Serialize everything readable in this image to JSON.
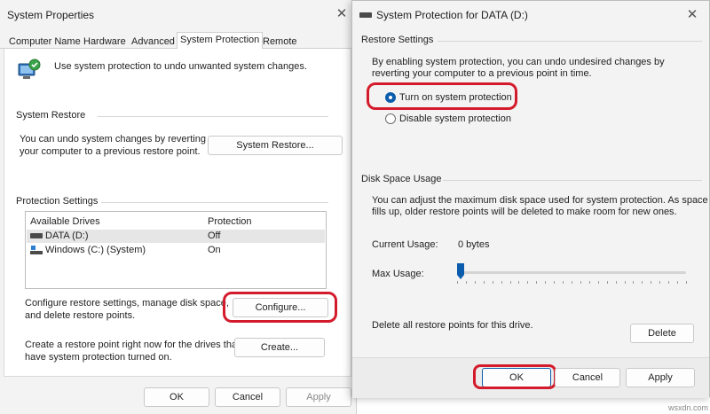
{
  "left_window": {
    "title": "System Properties",
    "close_glyph": "✕",
    "tabs": [
      "Computer Name",
      "Hardware",
      "Advanced",
      "System Protection",
      "Remote"
    ],
    "intro": "Use system protection to undo unwanted system changes.",
    "system_restore": {
      "heading": "System Restore",
      "line1": "You can undo system changes by reverting",
      "line2": "your computer to a previous restore point.",
      "button": "System Restore..."
    },
    "protection": {
      "heading": "Protection Settings",
      "col_drives": "Available Drives",
      "col_protection": "Protection",
      "rows": [
        {
          "name": "DATA (D:)",
          "status": "Off",
          "icon": "drive-icon"
        },
        {
          "name": "Windows (C:) (System)",
          "status": "On",
          "icon": "windows-drive-icon"
        }
      ],
      "configure_line1": "Configure restore settings, manage disk space,",
      "configure_line2": "and delete restore points.",
      "configure_button": "Configure...",
      "create_line1": "Create a restore point right now for the drives that",
      "create_line2": "have system protection turned on.",
      "create_button": "Create..."
    },
    "footer": {
      "ok": "OK",
      "cancel": "Cancel",
      "apply": "Apply"
    }
  },
  "right_window": {
    "title": "System Protection for DATA (D:)",
    "close_glyph": "✕",
    "restore_settings": {
      "heading": "Restore Settings",
      "line1": "By enabling system protection, you can undo undesired changes by",
      "line2": "reverting your computer to a previous point in time.",
      "option_on": "Turn on system protection",
      "option_off": "Disable system protection",
      "selected": "on"
    },
    "disk_space": {
      "heading": "Disk Space Usage",
      "line1": "You can adjust the maximum disk space used for system protection. As space",
      "line2": "fills up, older restore points will be deleted to make room for new ones.",
      "current_label": "Current Usage:",
      "current_value": "0 bytes",
      "max_label": "Max Usage:",
      "max_usage_fraction": 0.0,
      "delete_text": "Delete all restore points for this drive.",
      "delete_button": "Delete"
    },
    "footer": {
      "ok": "OK",
      "cancel": "Cancel",
      "apply": "Apply"
    }
  },
  "watermark": "wsxdn.com",
  "colors": {
    "highlight_red": "#d41b2c",
    "radio_blue": "#0b5cad",
    "slider_blue": "#0b5cad"
  }
}
